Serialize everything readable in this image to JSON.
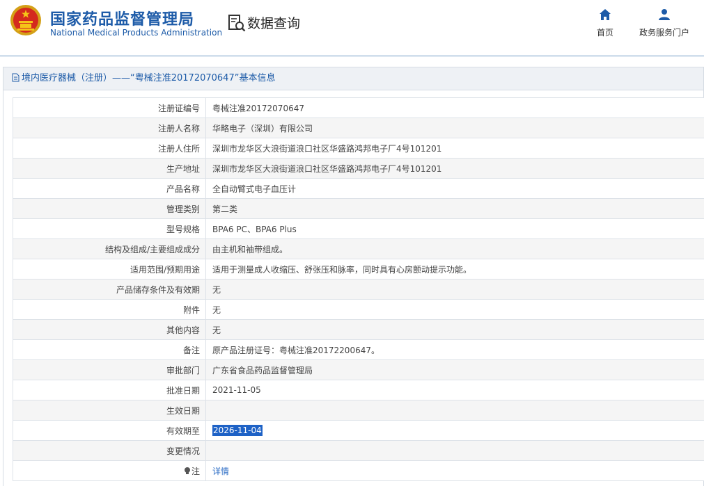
{
  "header": {
    "logo_cn": "国家药品监督管理局",
    "logo_en": "National Medical Products Administration",
    "section_title": "数据查询",
    "nav": [
      {
        "label": "首页",
        "icon": "home-icon"
      },
      {
        "label": "政务服务门户",
        "icon": "user-icon"
      }
    ]
  },
  "panel": {
    "title": "境内医疗器械（注册）——“粤械注准20172070647”基本信息"
  },
  "table": {
    "rows": [
      {
        "label": "注册证编号",
        "value": "粤械注准20172070647"
      },
      {
        "label": "注册人名称",
        "value": "华略电子（深圳）有限公司"
      },
      {
        "label": "注册人住所",
        "value": "深圳市龙华区大浪街道浪口社区华盛路鸿邦电子厂4号101201"
      },
      {
        "label": "生产地址",
        "value": "深圳市龙华区大浪街道浪口社区华盛路鸿邦电子厂4号101201"
      },
      {
        "label": "产品名称",
        "value": "全自动臂式电子血压计"
      },
      {
        "label": "管理类别",
        "value": "第二类"
      },
      {
        "label": "型号规格",
        "value": "BPA6 PC、BPA6 Plus"
      },
      {
        "label": "结构及组成/主要组成成分",
        "value": "由主机和袖带组成。"
      },
      {
        "label": "适用范围/预期用途",
        "value": "适用于测量成人收缩压、舒张压和脉率，同时具有心房颤动提示功能。"
      },
      {
        "label": "产品储存条件及有效期",
        "value": "无"
      },
      {
        "label": "附件",
        "value": "无"
      },
      {
        "label": "其他内容",
        "value": "无"
      },
      {
        "label": "备注",
        "value": "原产品注册证号：粤械注准20172200647。"
      },
      {
        "label": "审批部门",
        "value": "广东省食品药品监督管理局"
      },
      {
        "label": "批准日期",
        "value": "2021-11-05"
      },
      {
        "label": "生效日期",
        "value": ""
      },
      {
        "label": "有效期至",
        "value": "2026-11-04"
      },
      {
        "label": "变更情况",
        "value": ""
      },
      {
        "label": "注",
        "value": "详情"
      }
    ]
  }
}
